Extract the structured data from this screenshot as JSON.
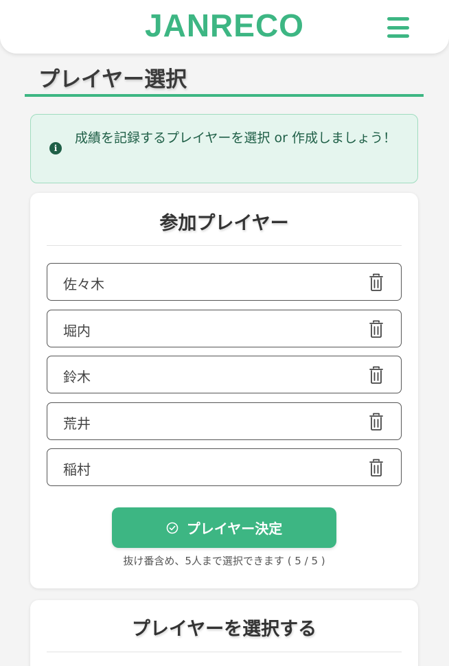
{
  "header": {
    "logo": "JANRECO",
    "menu_icon": "hamburger-menu-icon",
    "brand_color": "#3db683"
  },
  "page": {
    "title": "プレイヤー選択"
  },
  "info": {
    "icon": "info-icon",
    "message": "成績を記録するプレイヤーを選択 or 作成しましょう！"
  },
  "participants": {
    "title": "参加プレイヤー",
    "players": [
      {
        "name": "佐々木",
        "delete_icon": "trash-icon"
      },
      {
        "name": "堀内",
        "delete_icon": "trash-icon"
      },
      {
        "name": "鈴木",
        "delete_icon": "trash-icon"
      },
      {
        "name": "荒井",
        "delete_icon": "trash-icon"
      },
      {
        "name": "稲村",
        "delete_icon": "trash-icon"
      }
    ],
    "confirm_button": {
      "label": "プレイヤー決定",
      "icon": "check-circle-icon"
    },
    "note": "抜け番含め、5人まで選択できます ( 5 / 5 )"
  },
  "select_section": {
    "title": "プレイヤーを選択する"
  }
}
